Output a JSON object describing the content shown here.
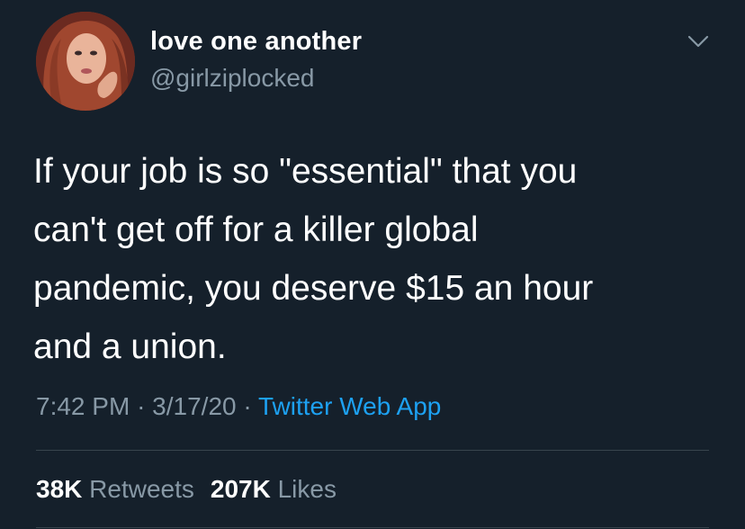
{
  "user": {
    "display_name": "love one another",
    "handle": "@girlziplocked"
  },
  "tweet": {
    "lines": [
      "If your job is so \"essential\" that you",
      "can't get off for a killer global",
      "pandemic, you deserve $15 an hour",
      "and a union."
    ],
    "time": "7:42 PM",
    "separator": "·",
    "date": "3/17/20",
    "source": "Twitter Web App"
  },
  "stats": {
    "retweets_count": "38K",
    "retweets_label": "Retweets",
    "likes_count": "207K",
    "likes_label": "Likes"
  },
  "icons": {
    "menu": "chevron-down-icon",
    "avatar": "profile-photo"
  },
  "colors": {
    "background": "#15202b",
    "text": "#ffffff",
    "secondary": "#8899a6",
    "link": "#1da1f2",
    "divider": "#38444d"
  }
}
